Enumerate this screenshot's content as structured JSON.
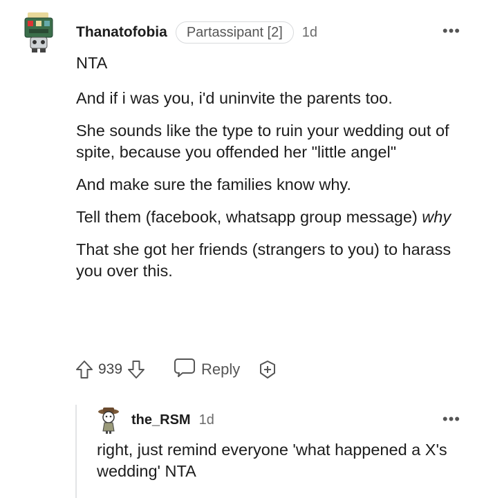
{
  "comment": {
    "author": "Thanatofobia",
    "flair": "Partassipant [2]",
    "age": "1d",
    "more_label": "•••",
    "paragraphs": [
      "NTA",
      "And if i was you, i'd uninvite the parents too.",
      "She sounds like the type to ruin your wedding out of spite, because you offended her \"little angel\"",
      "And make sure the families know why.",
      "That she got her friends (strangers to you) to harass you over this."
    ],
    "tell_them": {
      "text": "Tell them (facebook, whatsapp group message) ",
      "emphasis": "why"
    },
    "score": "939",
    "reply_label": "Reply"
  },
  "reply": {
    "author": "the_RSM",
    "age": "1d",
    "more_label": "•••",
    "text": "right, just remind everyone 'what happened a X's wedding' NTA"
  }
}
